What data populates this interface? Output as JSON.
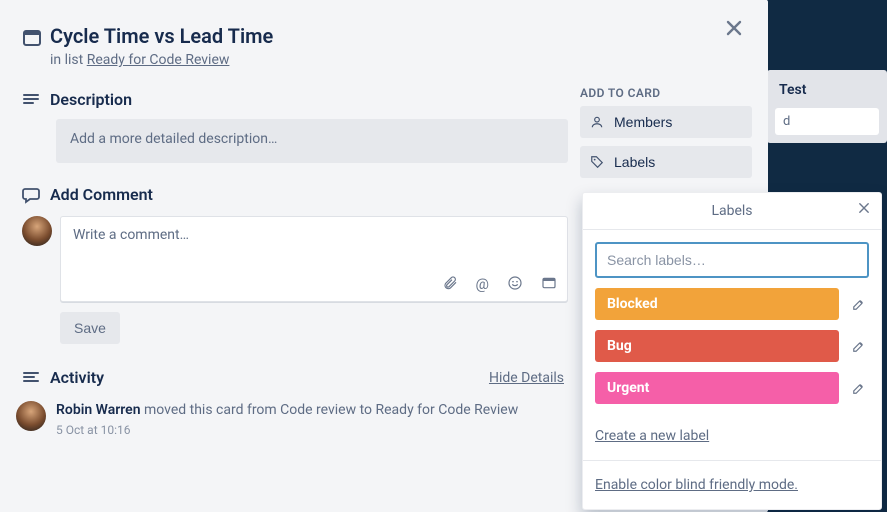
{
  "board": {
    "list_title": "Test",
    "card_placeholder": "d"
  },
  "card": {
    "title": "Cycle Time vs Lead Time",
    "list_prefix": "in list ",
    "list_name": "Ready for Code Review"
  },
  "description": {
    "heading": "Description",
    "placeholder": "Add a more detailed description…"
  },
  "comment": {
    "heading": "Add Comment",
    "placeholder": "Write a comment…",
    "save": "Save"
  },
  "activity": {
    "heading": "Activity",
    "hide": "Hide Details",
    "items": [
      {
        "name": "Robin Warren",
        "action": " moved this card from Code review to Ready for Code Review",
        "time": "5 Oct at 10:16"
      }
    ]
  },
  "sidebar": {
    "heading": "ADD TO CARD",
    "members": "Members",
    "labels": "Labels"
  },
  "labels_popover": {
    "title": "Labels",
    "search_placeholder": "Search labels…",
    "labels": [
      {
        "name": "Blocked",
        "color": "#f2a33a"
      },
      {
        "name": "Bug",
        "color": "#e05a49"
      },
      {
        "name": "Urgent",
        "color": "#f55fa8"
      }
    ],
    "create": "Create a new label",
    "colorblind": "Enable color blind friendly mode."
  }
}
